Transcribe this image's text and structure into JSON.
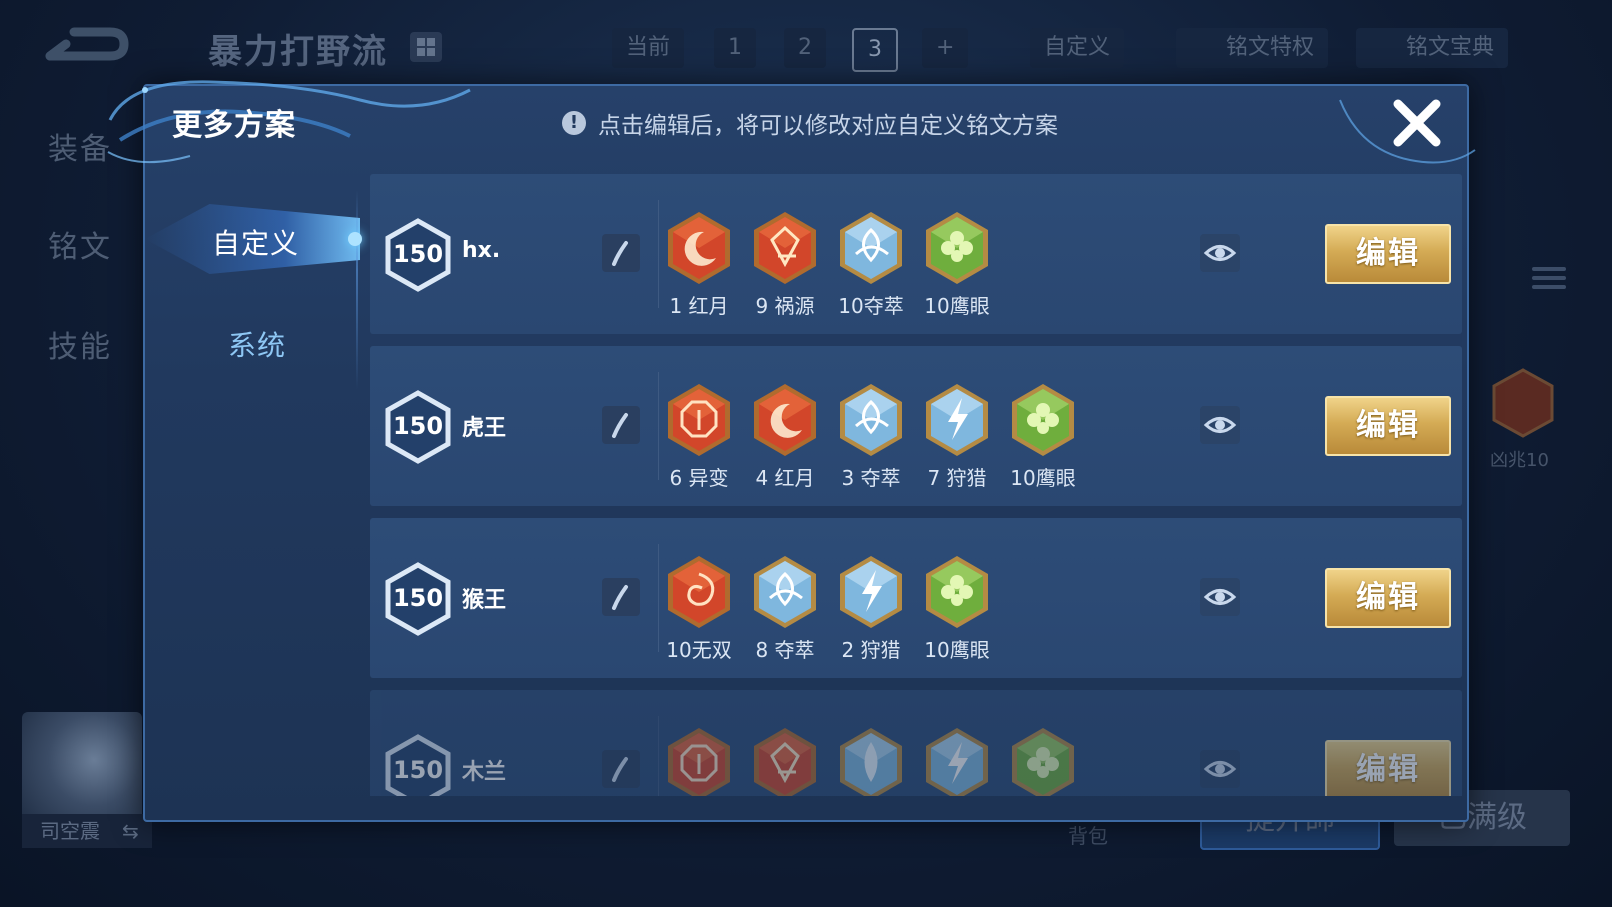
{
  "background": {
    "page_title": "暴力打野流",
    "tabs": [
      {
        "label": "当前"
      },
      {
        "label": "1"
      },
      {
        "label": "2"
      },
      {
        "label": "3"
      },
      {
        "label": "+"
      },
      {
        "label": "自定义"
      },
      {
        "label": "铭文特权"
      },
      {
        "label": "铭文宝典"
      }
    ],
    "side_nav": [
      "装备",
      "铭文",
      "技能"
    ],
    "hero_name": "司空震",
    "hero_swap": "⇆",
    "right_item_label": "凶兆10",
    "bag_label": "背包",
    "bottom_buttons": [
      "提升師",
      "已满级"
    ]
  },
  "modal": {
    "title": "更多方案",
    "notice_icon": "!",
    "notice": "点击编辑后，将可以修改对应自定义铭文方案",
    "tabs": {
      "custom": "自定义",
      "system": "系统"
    },
    "edit_label": "编辑",
    "schemes": [
      {
        "level": "150",
        "name": "hx.",
        "runes": [
          {
            "label": "1 红月",
            "color": "red",
            "icon": "crescent-rune-icon"
          },
          {
            "label": "9 祸源",
            "color": "red",
            "icon": "cards-rune-icon"
          },
          {
            "label": "10夺萃",
            "color": "blue",
            "icon": "triquetra-rune-icon"
          },
          {
            "label": "10鹰眼",
            "color": "green",
            "icon": "clover-rune-icon"
          }
        ]
      },
      {
        "level": "150",
        "name": "虎王",
        "runes": [
          {
            "label": "6 异变",
            "color": "red",
            "icon": "octagon-rune-icon"
          },
          {
            "label": "4 红月",
            "color": "red",
            "icon": "crescent-rune-icon"
          },
          {
            "label": "3 夺萃",
            "color": "blue",
            "icon": "triquetra-rune-icon"
          },
          {
            "label": "7 狩猎",
            "color": "blue",
            "icon": "lightning-rune-icon"
          },
          {
            "label": "10鹰眼",
            "color": "green",
            "icon": "clover-rune-icon"
          }
        ]
      },
      {
        "level": "150",
        "name": "猴王",
        "runes": [
          {
            "label": "10无双",
            "color": "red",
            "icon": "swirl-rune-icon"
          },
          {
            "label": "8 夺萃",
            "color": "blue",
            "icon": "triquetra-rune-icon"
          },
          {
            "label": "2 狩猎",
            "color": "blue",
            "icon": "lightning-rune-icon"
          },
          {
            "label": "10鹰眼",
            "color": "green",
            "icon": "clover-rune-icon"
          }
        ]
      },
      {
        "level": "150",
        "name": "木兰",
        "runes": [
          {
            "label": "",
            "color": "red",
            "icon": "octagon-rune-icon"
          },
          {
            "label": "",
            "color": "red",
            "icon": "cards-rune-icon"
          },
          {
            "label": "",
            "color": "blue",
            "icon": "drop-rune-icon"
          },
          {
            "label": "",
            "color": "blue",
            "icon": "lightning-rune-icon"
          },
          {
            "label": "",
            "color": "green",
            "icon": "clover-rune-icon"
          }
        ]
      }
    ]
  },
  "colors": {
    "red_gem": "#d2462a",
    "blue_gem": "#7fb7de",
    "green_gem": "#6fae3d",
    "gold_button": "#d4ab55",
    "modal_bg": "#23406a"
  }
}
